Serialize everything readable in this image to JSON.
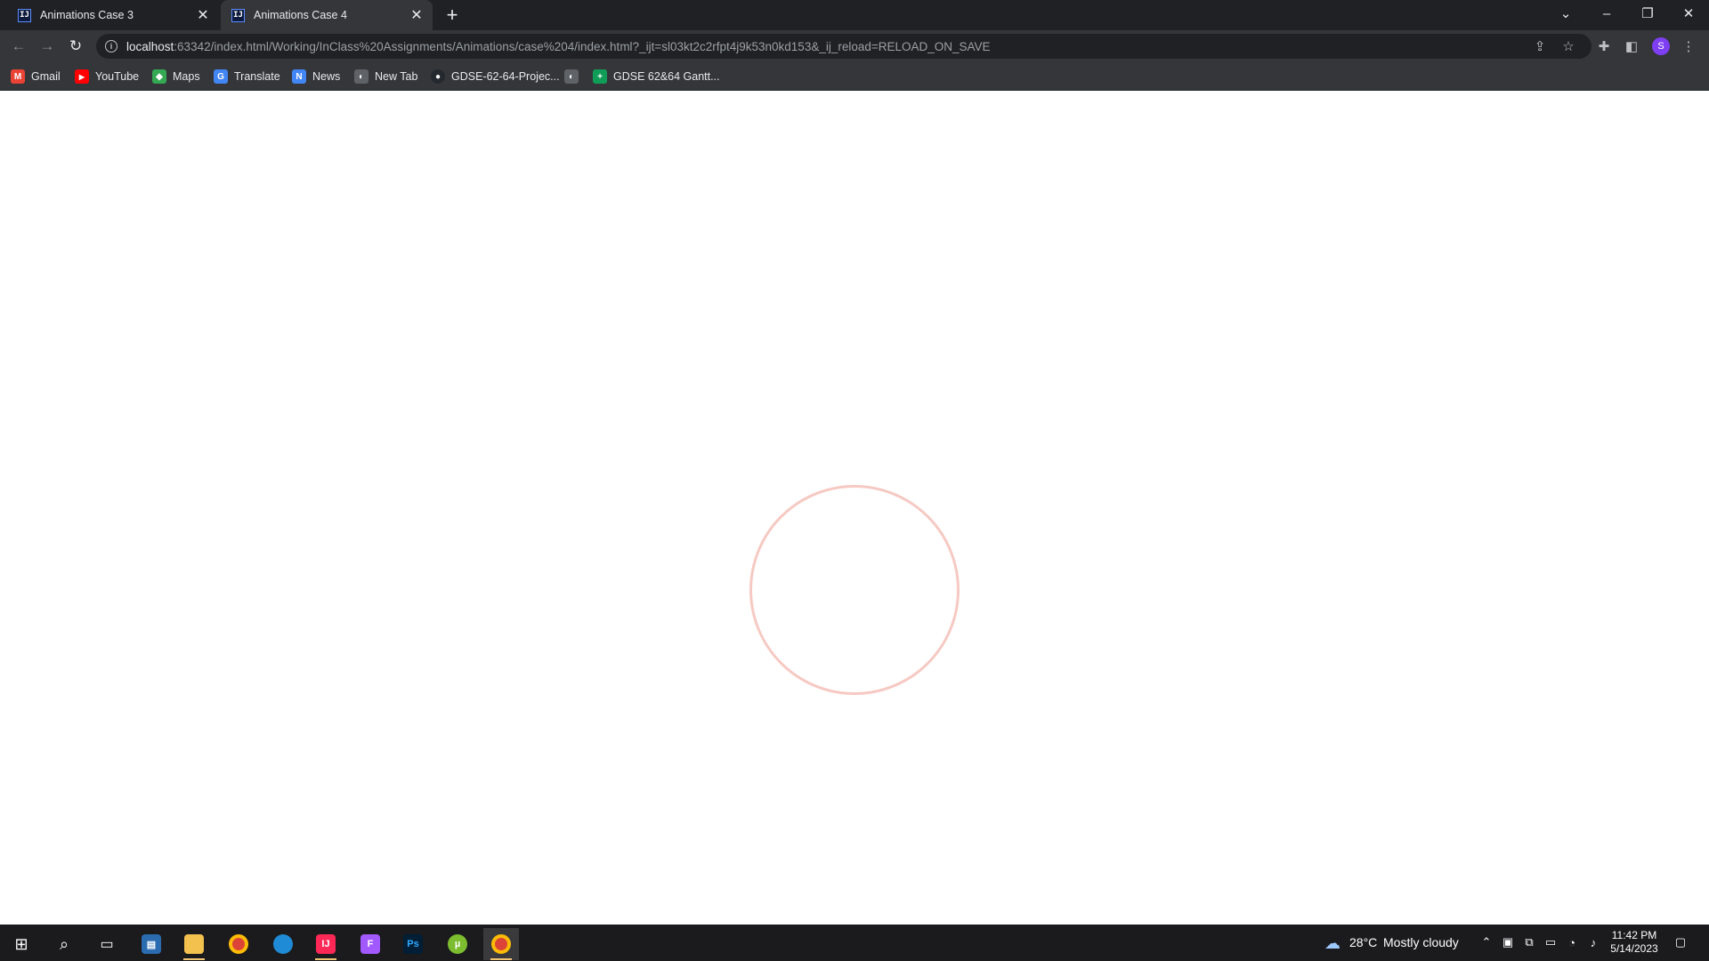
{
  "browser": {
    "tabs": [
      {
        "label": "Animations Case 3",
        "favicon": "IJ"
      },
      {
        "label": "Animations Case 4",
        "favicon": "IJ"
      }
    ],
    "address_bar": {
      "host": "localhost",
      "rest": ":63342/index.html/Working/InClass%20Assignments/Animations/case%204/index.html?_ijt=sl03kt2c2rfpt4j9k53n0kd153&_ij_reload=RELOAD_ON_SAVE"
    },
    "profile_initial": "S",
    "bookmarks": [
      {
        "label": "Gmail",
        "icon": "gmail-icon",
        "glyph": "M"
      },
      {
        "label": "YouTube",
        "icon": "youtube-icon",
        "glyph": "▶"
      },
      {
        "label": "Maps",
        "icon": "maps-icon",
        "glyph": "◆"
      },
      {
        "label": "Translate",
        "icon": "translate-icon",
        "glyph": "G"
      },
      {
        "label": "News",
        "icon": "news-icon",
        "glyph": "N"
      },
      {
        "label": "New Tab",
        "icon": "globe-icon",
        "glyph": "◐"
      },
      {
        "label": "GDSE-62-64-Projec...",
        "icon": "github-icon",
        "glyph": "●"
      },
      {
        "label": "",
        "icon": "globe-icon",
        "glyph": "◐"
      },
      {
        "label": "GDSE 62&64 Gantt...",
        "icon": "sheets-icon",
        "glyph": "+"
      }
    ]
  },
  "page": {
    "loader_color": "#f6c9c3"
  },
  "taskbar": {
    "weather": {
      "temp": "28°C",
      "condition": "Mostly cloudy"
    },
    "time": "11:42 PM",
    "date": "5/14/2023"
  },
  "colors": {
    "tabbar": "#202124",
    "toolbar": "#35363a",
    "taskbar": "#1b1b1d"
  }
}
